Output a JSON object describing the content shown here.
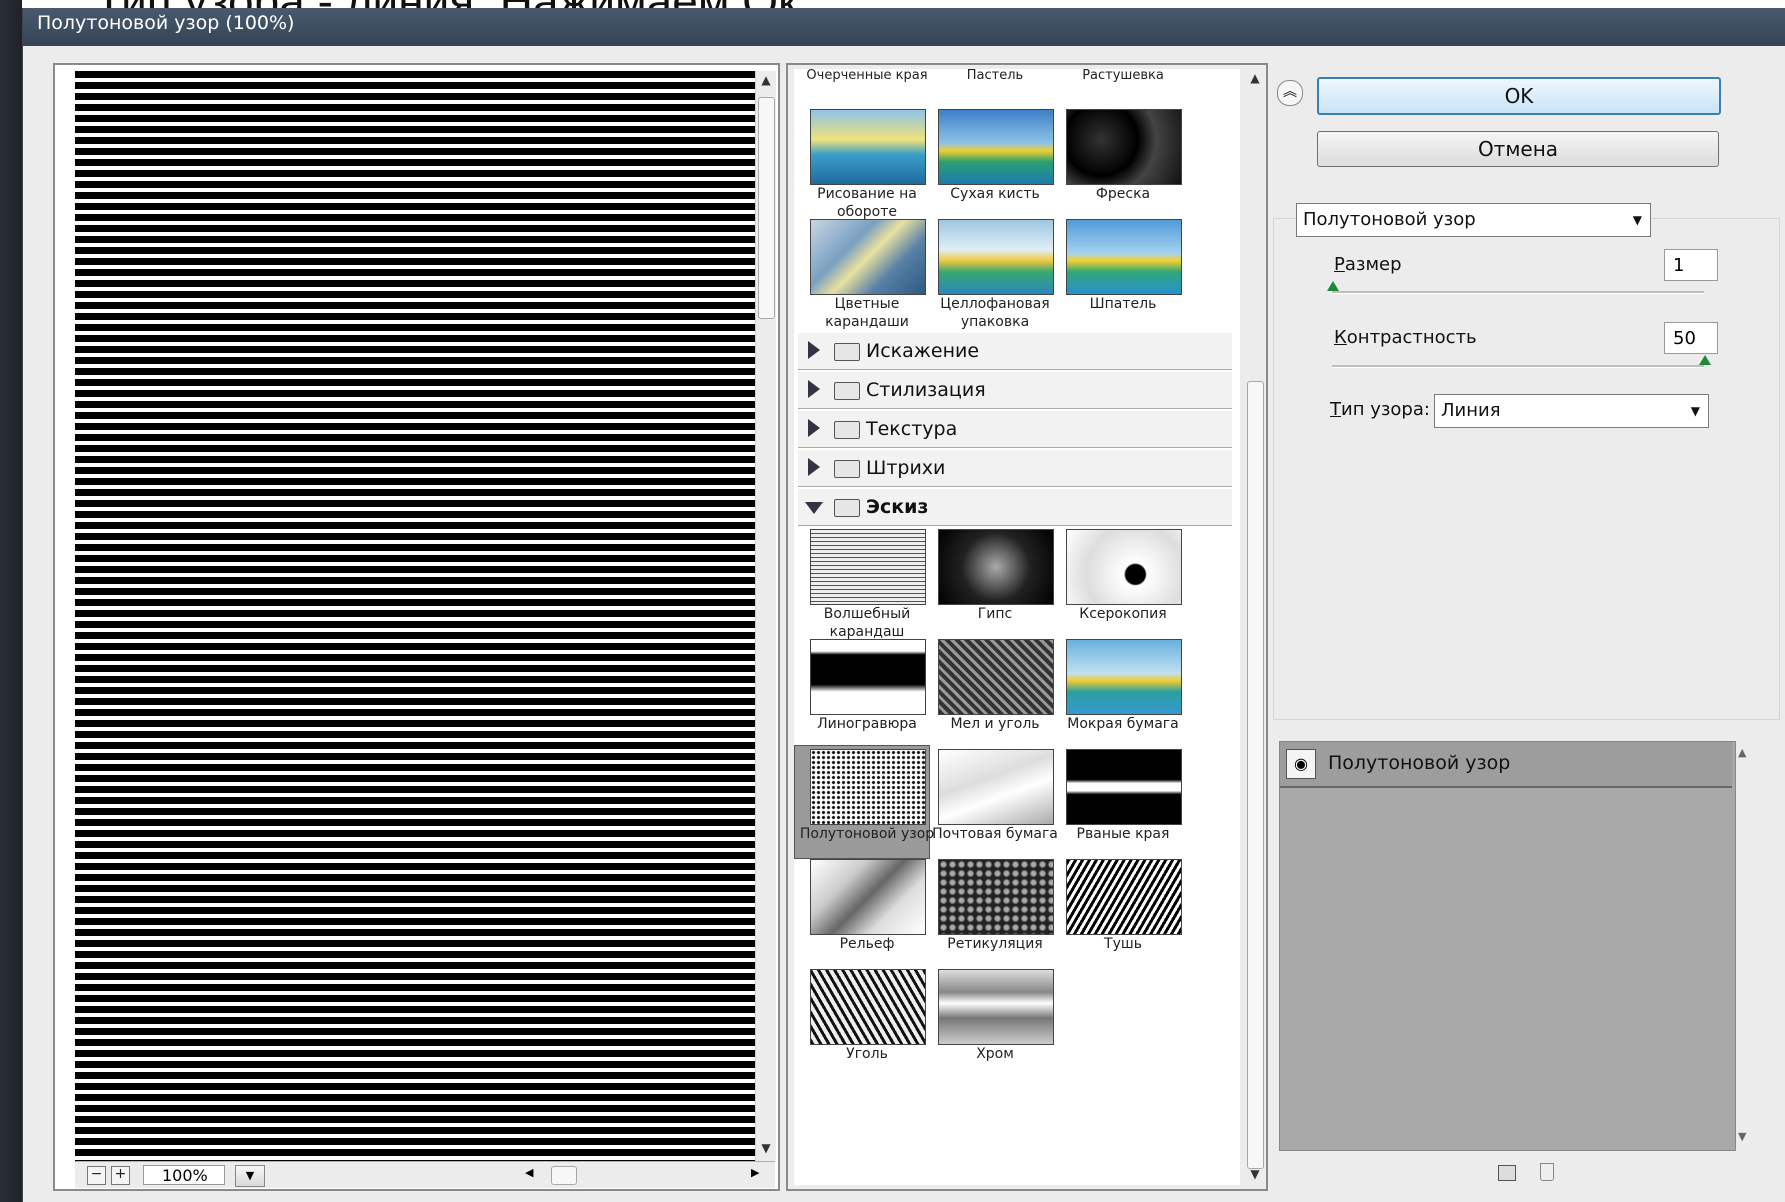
{
  "caption": "Тип узора - линия. Нажимаем Ок",
  "window": {
    "title": "Полутоновой узор (100%)"
  },
  "preview": {
    "zoom": "100%",
    "zoom_out": "−",
    "zoom_in": "+"
  },
  "gallery": {
    "top_labels": [
      "Очерченные края",
      "Пастель",
      "Растушевка"
    ],
    "artistic": [
      {
        "label": "Рисование на обороте"
      },
      {
        "label": "Сухая кисть"
      },
      {
        "label": "Фреска"
      },
      {
        "label": "Цветные карандаши"
      },
      {
        "label": "Целлофановая упаковка"
      },
      {
        "label": "Шпатель"
      }
    ],
    "folders": [
      {
        "label": "Искажение",
        "open": false
      },
      {
        "label": "Стилизация",
        "open": false
      },
      {
        "label": "Текстура",
        "open": false
      },
      {
        "label": "Штрихи",
        "open": false
      },
      {
        "label": "Эскиз",
        "open": true
      }
    ],
    "sketch": [
      {
        "label": "Волшебный карандаш"
      },
      {
        "label": "Гипс"
      },
      {
        "label": "Ксерокопия"
      },
      {
        "label": "Линогравюра"
      },
      {
        "label": "Мел и уголь"
      },
      {
        "label": "Мокрая бумага"
      },
      {
        "label": "Полутоновой узор",
        "selected": true
      },
      {
        "label": "Почтовая бумага"
      },
      {
        "label": "Рваные края"
      },
      {
        "label": "Рельеф"
      },
      {
        "label": "Ретикуляция"
      },
      {
        "label": "Тушь"
      },
      {
        "label": "Уголь"
      },
      {
        "label": "Хром"
      }
    ]
  },
  "actions": {
    "ok": "OK",
    "cancel": "Отмена"
  },
  "settings": {
    "filter_select": "Полутоновой узор",
    "size_label_u": "Р",
    "size_label_rest": "азмер",
    "size_value": "1",
    "contrast_label_u": "К",
    "contrast_label_rest": "онтрастность",
    "contrast_value": "50",
    "pattern_label_u": "Т",
    "pattern_label_rest": "ип узора:",
    "pattern_value": "Линия"
  },
  "layers": {
    "name": "Полутоновой узор"
  },
  "icons": {
    "collapse": "double-chevron-up-icon",
    "eye": "eye-icon",
    "new_layer": "new-layer-icon",
    "delete": "trash-icon"
  }
}
